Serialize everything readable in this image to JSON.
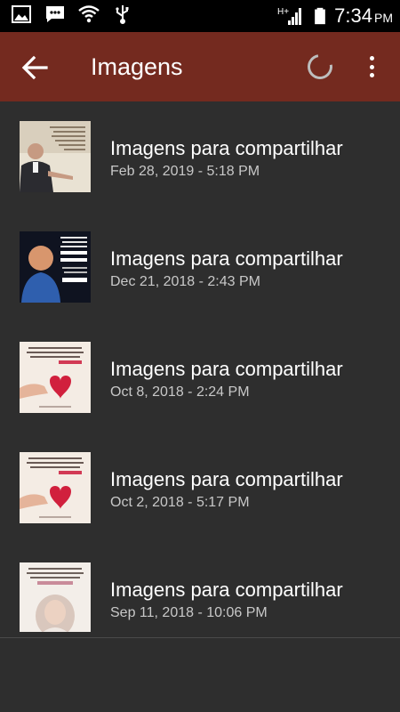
{
  "status_bar": {
    "time": "7:34",
    "ampm": "PM",
    "network": "H+",
    "icons": [
      "image-icon",
      "message-icon",
      "wifi-icon",
      "usb-icon",
      "signal-icon",
      "battery-icon"
    ]
  },
  "app_bar": {
    "title": "Imagens",
    "color": "#742a1f"
  },
  "items": [
    {
      "title": "Imagens para compartilhar",
      "date": "Feb 28, 2019 - 5:18 PM",
      "thumb": "preacher-quote-image"
    },
    {
      "title": "Imagens para compartilhar",
      "date": "Dec 21, 2018 - 2:43 PM",
      "thumb": "man-portrait-quote-image"
    },
    {
      "title": "Imagens para compartilhar",
      "date": "Oct 8, 2018 - 2:24 PM",
      "thumb": "heart-hand-quote-image"
    },
    {
      "title": "Imagens para compartilhar",
      "date": "Oct 2, 2018 - 5:17 PM",
      "thumb": "heart-hand-quote-image"
    },
    {
      "title": "Imagens para compartilhar",
      "date": "Sep 11, 2018 - 10:06 PM",
      "thumb": "woman-quote-image"
    }
  ]
}
